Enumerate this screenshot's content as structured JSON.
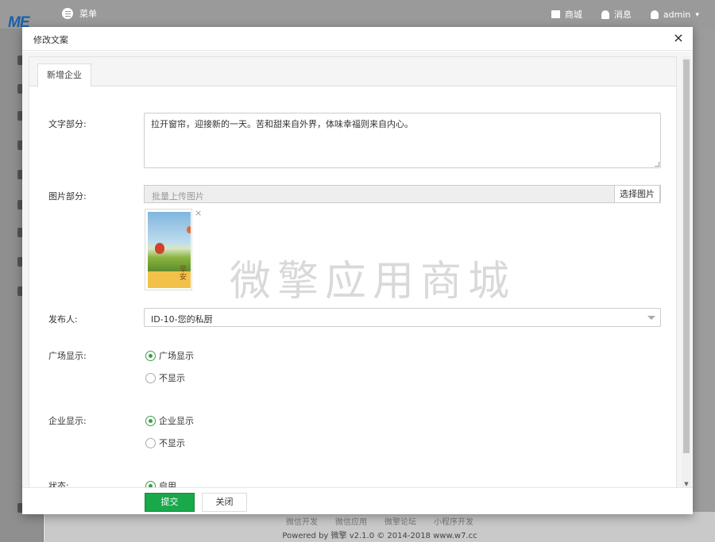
{
  "app": {
    "logo": "ME",
    "menu_label": "菜单",
    "header_links": [
      "商城",
      "消息",
      "admin"
    ],
    "footer_links": [
      "微信开发",
      "微信应用",
      "微擎论坛",
      "小程序开发"
    ],
    "footer_powered": "Powered by 微擎 v2.1.0 © 2014-2018 www.w7.cc"
  },
  "modal": {
    "title": "修改文案",
    "close_glyph": "×",
    "tab": "新增企业",
    "watermark": "微擎应用商城",
    "form": {
      "text_label": "文字部分:",
      "text_value": "拉开窗帘，迎接新的一天。苦和甜来自外界，体味幸福则来自内心。",
      "image_label": "图片部分:",
      "upload_placeholder": "批量上传图片",
      "upload_button": "选择图片",
      "image_caption": "早安",
      "remove_glyph": "×",
      "publisher_label": "发布人:",
      "publisher_value": "ID-10-您的私厨",
      "plaza_label": "广场显示:",
      "plaza_options": [
        "广场显示",
        "不显示"
      ],
      "plaza_selected": "广场显示",
      "company_label": "企业显示:",
      "company_options": [
        "企业显示",
        "不显示"
      ],
      "company_selected": "企业显示",
      "status_label": "状态:",
      "status_option": "启用"
    },
    "buttons": {
      "submit": "提交",
      "close": "关闭"
    }
  },
  "colors": {
    "primary_green": "#19a84a",
    "radio_green": "#3e9e4a"
  }
}
